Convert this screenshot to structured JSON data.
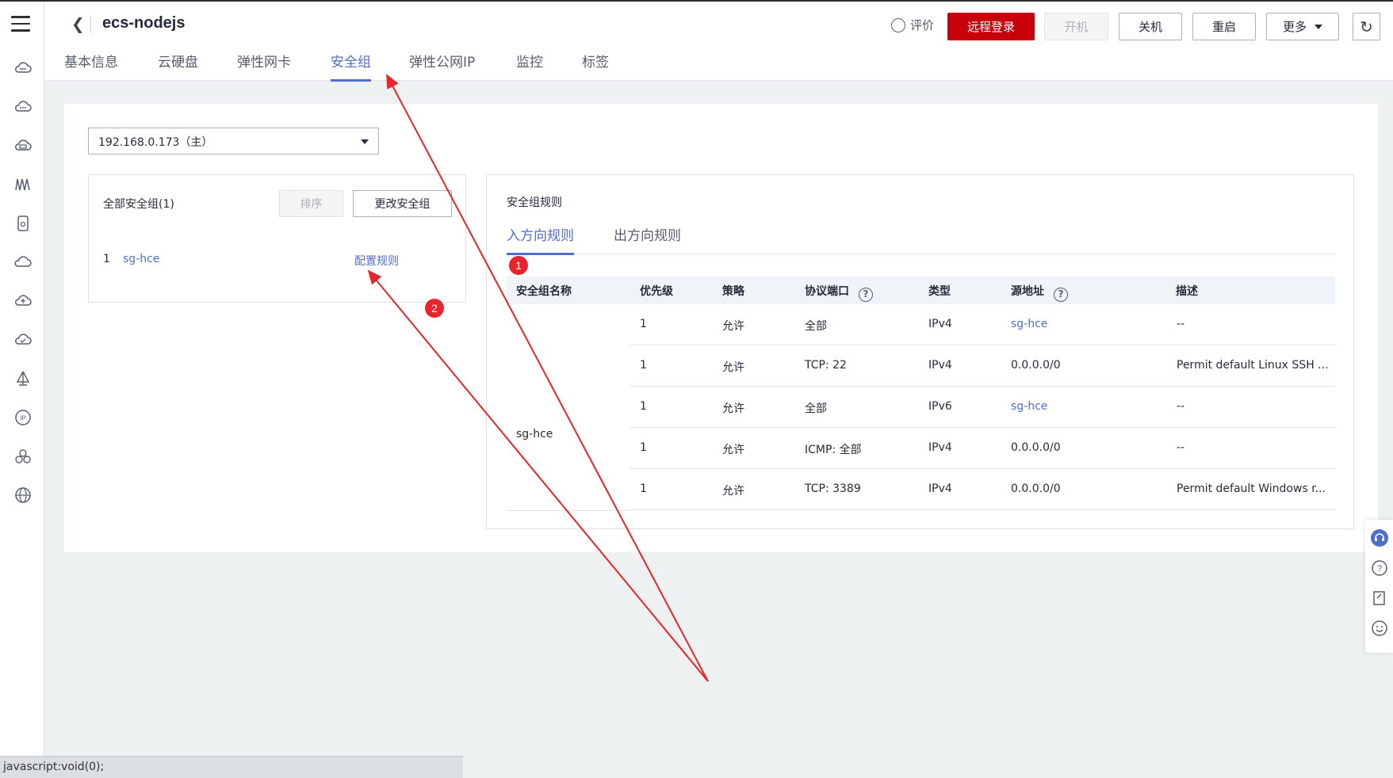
{
  "header": {
    "title": "ecs-nodejs",
    "evaluate_label": "评价",
    "buttons": {
      "remote_login": "远程登录",
      "power_on": "开机",
      "power_off": "关机",
      "restart": "重启",
      "more": "更多"
    }
  },
  "tabs": [
    "基本信息",
    "云硬盘",
    "弹性网卡",
    "安全组",
    "弹性公网IP",
    "监控",
    "标签"
  ],
  "active_tab": "安全组",
  "nic_select": {
    "value": "192.168.0.173（主）"
  },
  "left_panel": {
    "title": "全部安全组(1)",
    "sort_button": "排序",
    "change_button": "更改安全组",
    "groups": [
      {
        "index": "1",
        "name": "sg-hce",
        "action": "配置规则"
      }
    ]
  },
  "rules_panel": {
    "title": "安全组规则",
    "tabs": [
      "入方向规则",
      "出方向规则"
    ],
    "active_tab": "入方向规则",
    "columns": [
      "安全组名称",
      "优先级",
      "策略",
      "协议端口",
      "类型",
      "源地址",
      "描述"
    ],
    "group_name": "sg-hce",
    "rows": [
      {
        "priority": "1",
        "policy": "允许",
        "protocol_port": "全部",
        "type": "IPv4",
        "source": "sg-hce",
        "description": "--"
      },
      {
        "priority": "1",
        "policy": "允许",
        "protocol_port": "TCP: 22",
        "type": "IPv4",
        "source": "0.0.0.0/0",
        "description": "Permit default Linux SSH ..."
      },
      {
        "priority": "1",
        "policy": "允许",
        "protocol_port": "全部",
        "type": "IPv6",
        "source": "sg-hce",
        "description": "--"
      },
      {
        "priority": "1",
        "policy": "允许",
        "protocol_port": "ICMP: 全部",
        "type": "IPv4",
        "source": "0.0.0.0/0",
        "description": "--"
      },
      {
        "priority": "1",
        "policy": "允许",
        "protocol_port": "TCP: 3389",
        "type": "IPv4",
        "source": "0.0.0.0/0",
        "description": "Permit default Windows r..."
      }
    ]
  },
  "annotations": {
    "badge1": "1",
    "badge2": "2"
  },
  "status_bar": "javascript:void(0);",
  "colors": {
    "accent": "#526ecc",
    "danger": "#c7000b",
    "annotation": "#e8252b"
  },
  "rail_icons": [
    "cloud-icon",
    "cloud-dots-icon",
    "cloud-disk-icon",
    "network-icon",
    "storage-icon",
    "cloud-alt-icon",
    "cloud-upload-icon",
    "cloud-check-icon",
    "sail-icon",
    "ip-icon",
    "cluster-icon",
    "globe-icon"
  ]
}
